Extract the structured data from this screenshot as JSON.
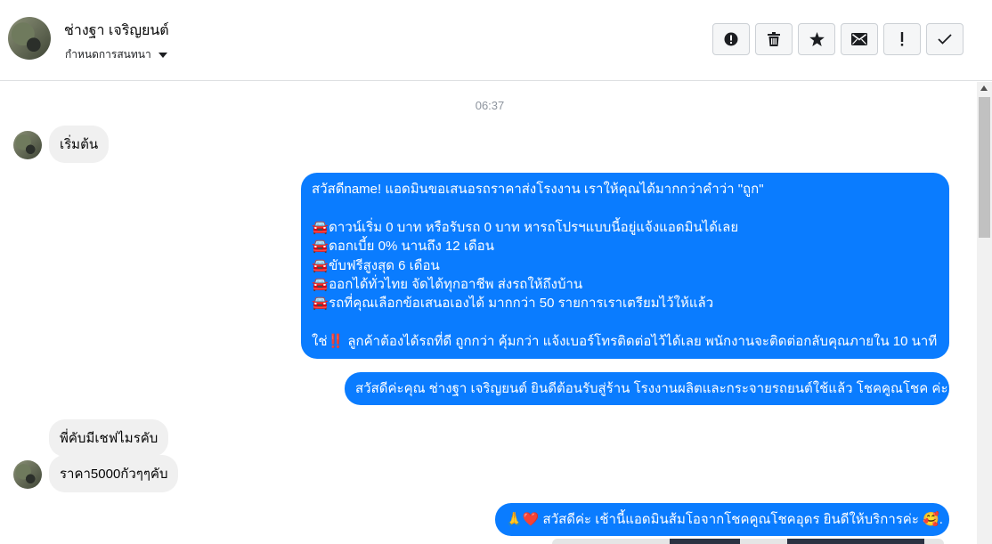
{
  "header": {
    "contact_name": "ช่างฐา เจริญยนต์",
    "assign_label": "กำหนดการสนทนา",
    "actions": [
      {
        "icon": "alert-circle-icon"
      },
      {
        "icon": "trash-icon"
      },
      {
        "icon": "star-icon"
      },
      {
        "icon": "envelope-icon"
      },
      {
        "icon": "exclamation-icon"
      },
      {
        "icon": "check-icon"
      }
    ]
  },
  "chat": {
    "timestamp": "06:37",
    "messages": [
      {
        "from": "contact",
        "text": "เริ่มต้น"
      },
      {
        "from": "page",
        "lines": [
          "สวัสดีname! แอดมินขอเสนอรถราคาส่งโรงงาน เราให้คุณได้มากกว่าคำว่า \"ถูก\"",
          "",
          "ดาวน์เริ่ม 0 บาท หรือรับรถ 0 บาท หารถโปรฯแบบนี้อยู่แจ้งแอดมินได้เลย",
          "ดอกเบี้ย 0% นานถึง 12 เดือน",
          "ขับฟรีสูงสุด 6 เดือน",
          "ออกได้ทั่วไทย จัดได้ทุกอาชีพ ส่งรถให้ถึงบ้าน",
          "รถที่คุณเลือกข้อเสนอเองได้ มากกว่า 50 รายการเราเตรียมไว้ให้แล้ว",
          "",
          "ใช่‼️ ลูกค้าต้องได้รถที่ดี ถูกกว่า คุ้มกว่า แจ้งเบอร์โทรติดต่อไว้ได้เลย พนักงานจะติดต่อกลับคุณภายใน 10 นาที"
        ]
      },
      {
        "from": "page",
        "text": "สวัสดีค่ะคุณ ช่างฐา เจริญยนต์ ยินดีต้อนรับสู่ร้าน โรงงานผลิตและกระจายรถยนต์ใช้แล้ว โชคคูณโชค ค่ะ"
      },
      {
        "from": "contact",
        "text": "พี่คับมีเชฟไมรคับ"
      },
      {
        "from": "contact",
        "text": "ราคา5000กัวๆๆคับ"
      },
      {
        "from": "page",
        "text": "🙏❤️ สวัสดีค่ะ เช้านี้แอดมินส้มโอจากโชคคูณโชคอุดร ยินดีให้บริการค่ะ 🥰."
      }
    ],
    "car_emoji": "🚘"
  }
}
